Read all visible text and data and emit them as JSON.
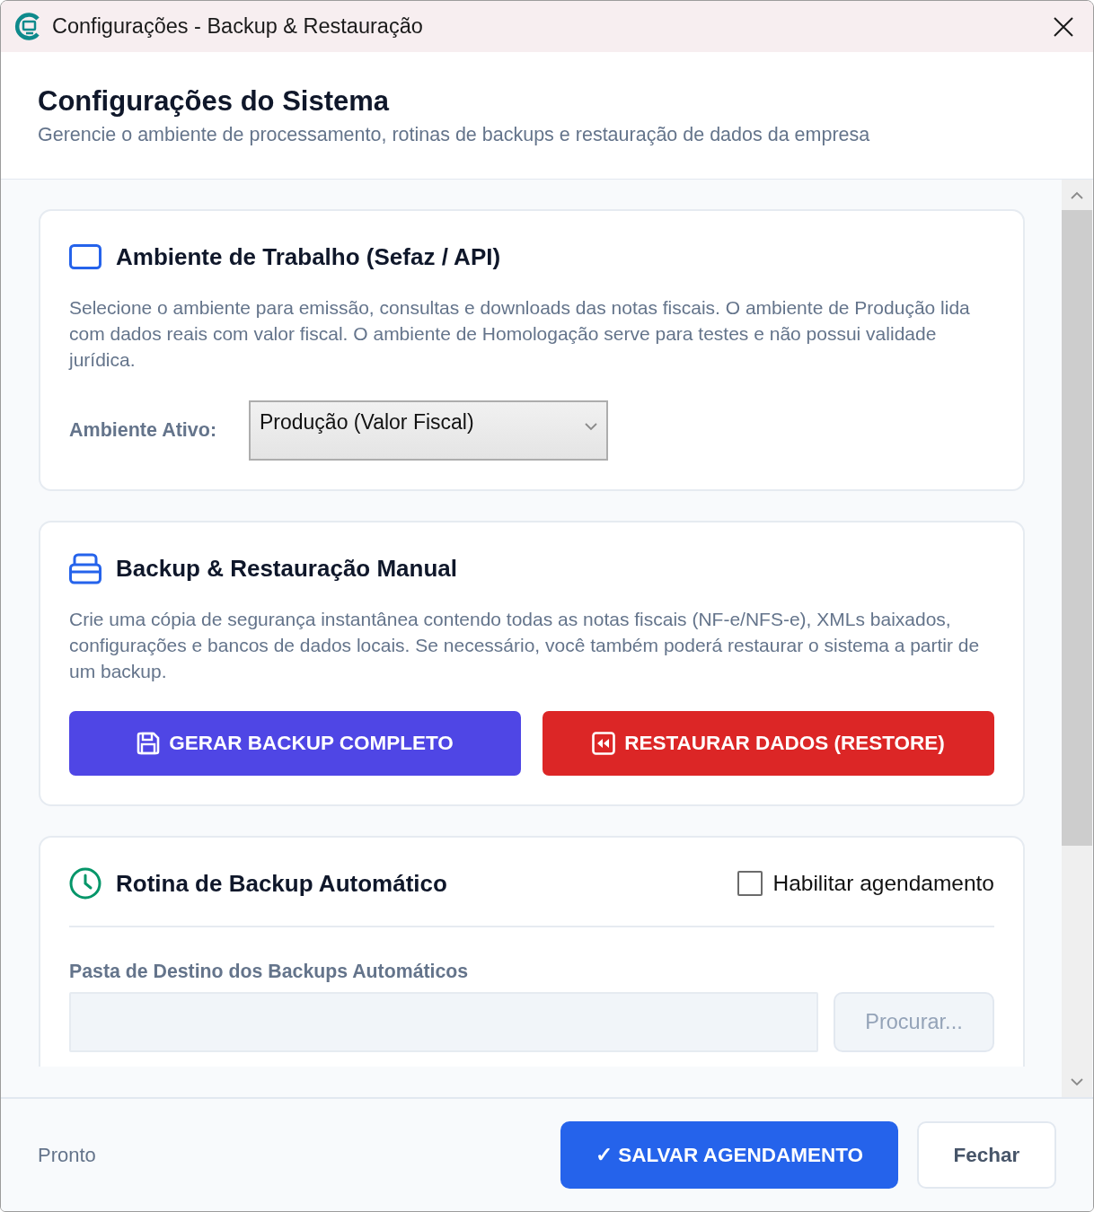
{
  "window": {
    "title": "Configurações - Backup & Restauração"
  },
  "header": {
    "title": "Configurações do Sistema",
    "subtitle": "Gerencie o ambiente de processamento, rotinas de backups e restauração de dados da empresa"
  },
  "sections": [
    {
      "kind": "environment",
      "title": "Ambiente de Trabalho (Sefaz / API)",
      "description": "Selecione o ambiente para emissão, consultas e downloads das notas fiscais. O ambiente de Produção lida com dados reais com valor fiscal. O ambiente de Homologação serve para testes e não possui validade jurídica.",
      "field_label": "Ambiente Ativo:",
      "select": {
        "value": "Produção (Valor Fiscal)"
      }
    },
    {
      "kind": "manual_backup",
      "title": "Backup & Restauração Manual",
      "description": "Crie uma cópia de segurança instantânea contendo todas as notas fiscais (NF-e/NFS-e), XMLs baixados, configurações e bancos de dados locais. Se necessário, você também poderá restaurar o sistema a partir de um backup.",
      "buttons": [
        {
          "kind": "backup",
          "label": "GERAR BACKUP COMPLETO"
        },
        {
          "kind": "restore",
          "label": "RESTAURAR DADOS (RESTORE)"
        }
      ]
    },
    {
      "kind": "schedule",
      "title": "Rotina de Backup Automático",
      "toggle": {
        "label": "Habilitar agendamento",
        "checked": false
      },
      "folder_label": "Pasta de Destino dos Backups Automáticos",
      "folder_field": {
        "disabled": true
      },
      "browse_button": {
        "label": "Procurar...",
        "disabled": true
      }
    }
  ],
  "status_bar": {
    "status": "Pronto",
    "buttons": [
      {
        "kind": "primary",
        "label": "✓ SALVAR AGENDAMENTO"
      },
      {
        "kind": "secondary",
        "label": "Fechar"
      }
    ]
  }
}
